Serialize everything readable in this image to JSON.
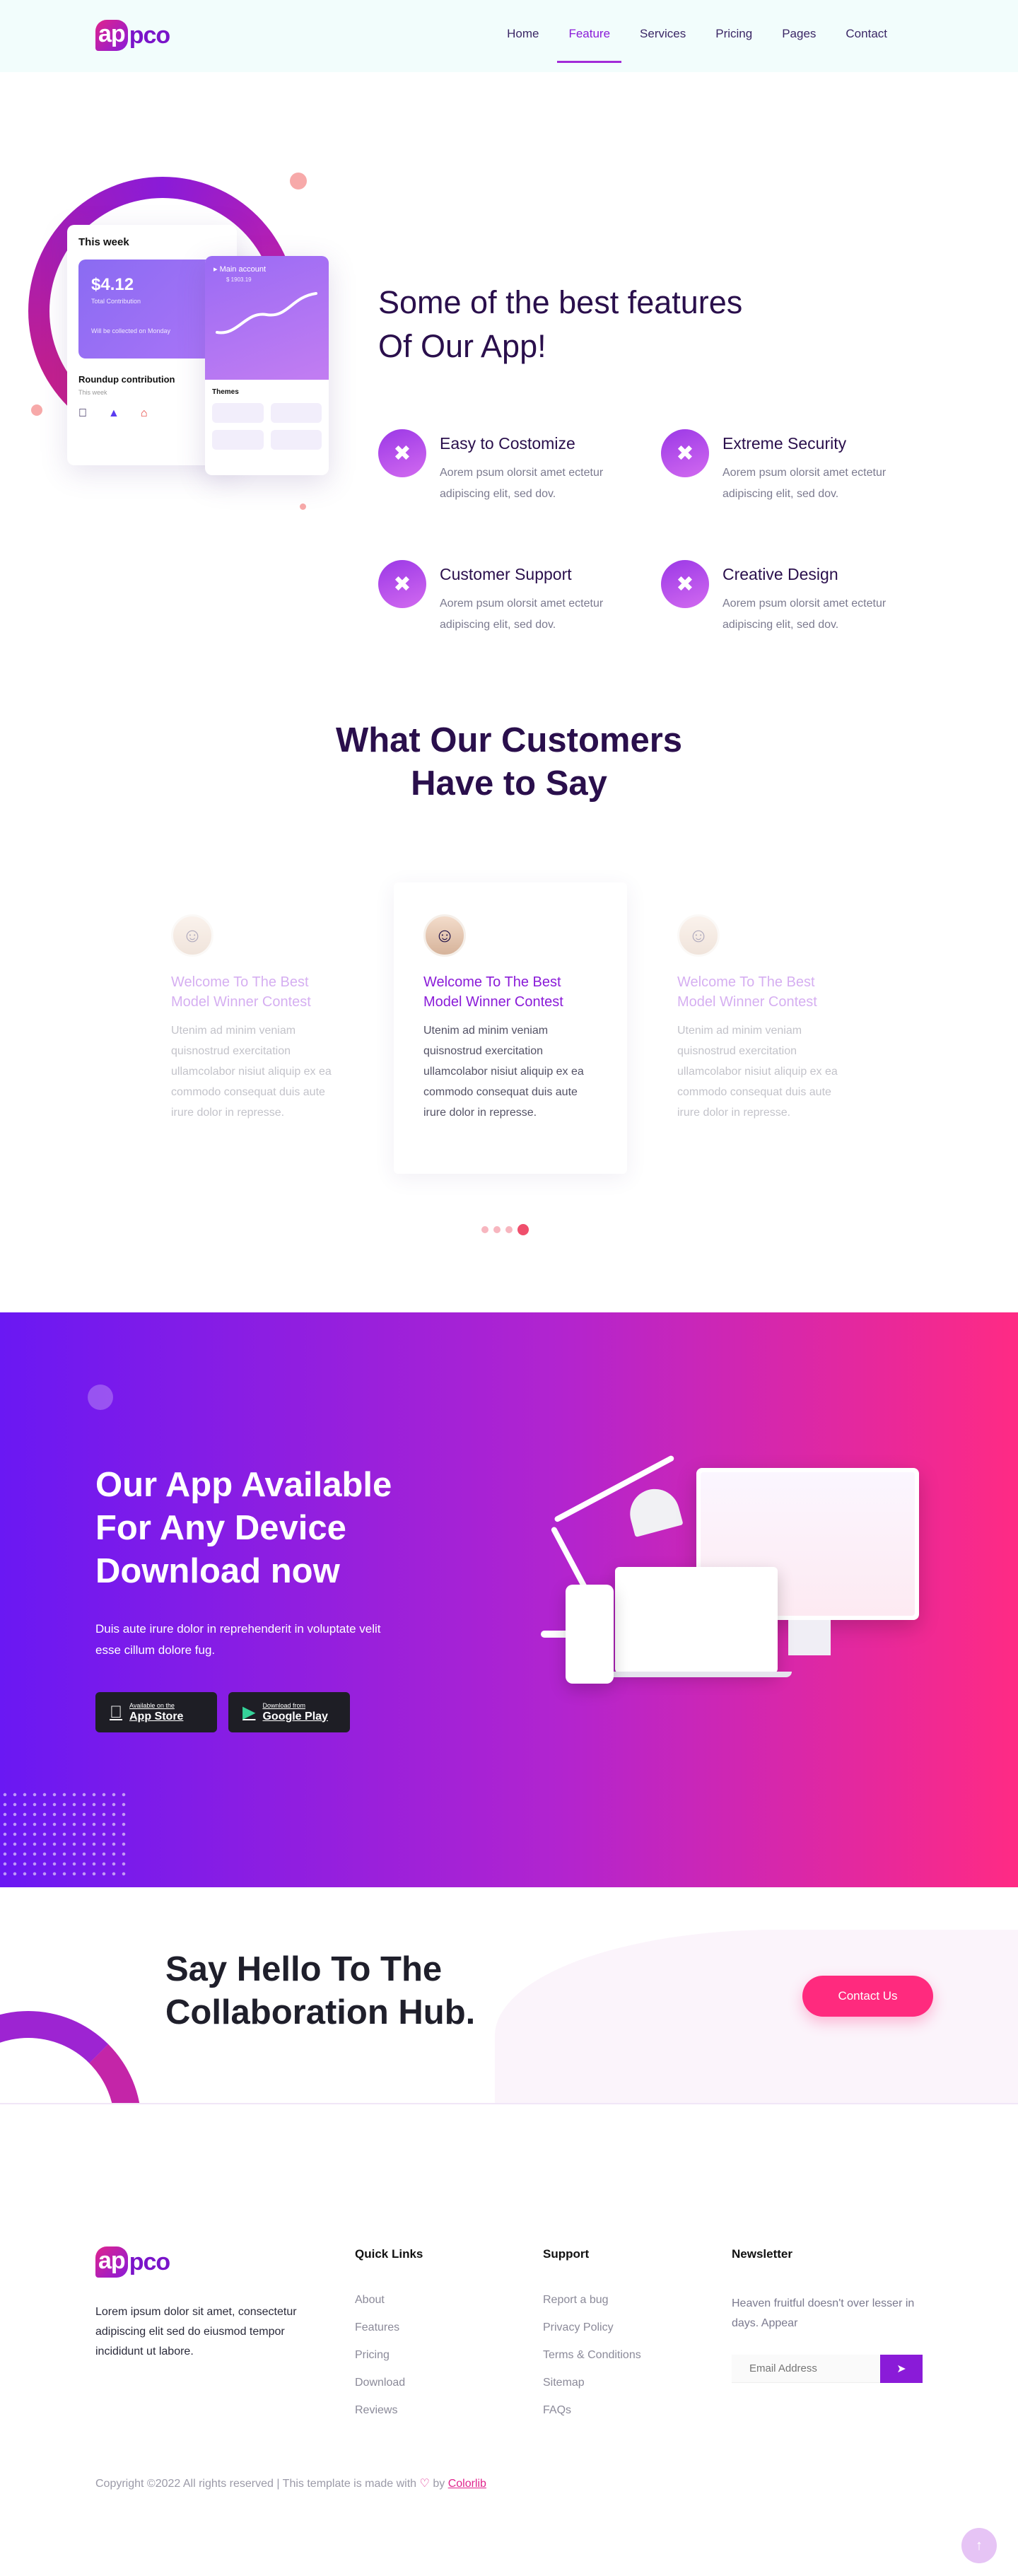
{
  "header": {
    "logo_part1": "ap",
    "logo_part2": "pco",
    "nav": [
      "Home",
      "Feature",
      "Services",
      "Pricing",
      "Pages",
      "Contact"
    ],
    "active_nav": "Feature"
  },
  "features": {
    "mockup": {
      "week_title": "This week",
      "amount": "$4.12",
      "amount_sub": "Total Contribution",
      "amount_note": "Will be collected on Monday",
      "roundup": "Roundup contribution",
      "roundup_sub": "This week",
      "main_account": "Main account",
      "main_account_sub": "$ 1903.19",
      "themes": "Themes"
    },
    "title_line1": "Some of the best features",
    "title_line2": "Of Our App!",
    "items": [
      {
        "title": "Easy to Costomize",
        "text": "Aorem psum olorsit amet ectetur adipiscing elit, sed dov."
      },
      {
        "title": "Extreme Security",
        "text": "Aorem psum olorsit amet ectetur adipiscing elit, sed dov."
      },
      {
        "title": "Customer Support",
        "text": "Aorem psum olorsit amet ectetur adipiscing elit, sed dov."
      },
      {
        "title": "Creative Design",
        "text": "Aorem psum olorsit amet ectetur adipiscing elit, sed dov."
      }
    ]
  },
  "testimonials": {
    "title_line1": "What Our Customers",
    "title_line2": "Have to Say",
    "cards": [
      {
        "heading": "Welcome To The Best Model Winner Contest",
        "text": "Utenim ad minim veniam quisnostrud exercitation ullamcolabor nisiut aliquip ex ea commodo consequat duis aute irure dolor in represse."
      },
      {
        "heading": "Welcome To The Best Model Winner Contest",
        "text": "Utenim ad minim veniam quisnostrud exercitation ullamcolabor nisiut aliquip ex ea commodo consequat duis aute irure dolor in represse."
      },
      {
        "heading": "Welcome To The Best Model Winner Contest",
        "text": "Utenim ad minim veniam quisnostrud exercitation ullamcolabor nisiut aliquip ex ea commodo consequat duis aute irure dolor in represse."
      }
    ]
  },
  "app_banner": {
    "title_line1": "Our App Available",
    "title_line2": "For Any Device",
    "title_line3": "Download now",
    "text": "Duis aute irure dolor in reprehenderit in voluptate velit esse cillum dolore fug.",
    "appstore_small": "Available on the",
    "appstore_large": "App Store",
    "googleplay_small": "Download from",
    "googleplay_large": "Google Play"
  },
  "cta": {
    "title_line1": "Say Hello To The",
    "title_line2": "Collaboration Hub.",
    "button": "Contact Us"
  },
  "footer": {
    "about": "Lorem ipsum dolor sit amet, consectetur adipiscing elit sed do eiusmod tempor incididunt ut labore.",
    "quick_links_title": "Quick Links",
    "quick_links": [
      "About",
      "Features",
      "Pricing",
      "Download",
      "Reviews"
    ],
    "support_title": "Support",
    "support_links": [
      "Report a bug",
      "Privacy Policy",
      "Terms & Conditions",
      "Sitemap",
      "FAQs"
    ],
    "newsletter_title": "Newsletter",
    "newsletter_text": "Heaven fruitful doesn't over lesser in days. Appear",
    "email_placeholder": "Email Address",
    "copyright_prefix": "Copyright ©2022 All rights reserved | This template is made with",
    "copyright_by": "by",
    "copyright_brand": "Colorlib"
  }
}
